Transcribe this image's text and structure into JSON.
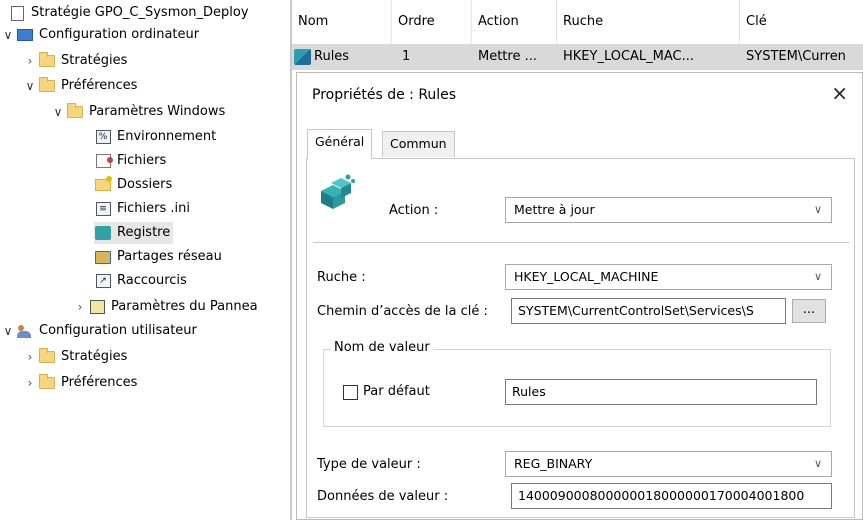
{
  "tree": {
    "root": "Stratégie GPO_C_Sysmon_Deploy",
    "items": [
      {
        "label": "Configuration ordinateur"
      },
      {
        "label": "Stratégies"
      },
      {
        "label": "Préférences"
      },
      {
        "label": "Paramètres Windows"
      },
      {
        "label": "Environnement"
      },
      {
        "label": "Fichiers"
      },
      {
        "label": "Dossiers"
      },
      {
        "label": "Fichiers .ini"
      },
      {
        "label": "Registre"
      },
      {
        "label": "Partages réseau"
      },
      {
        "label": "Raccourcis"
      },
      {
        "label": "Paramètres du Pannea"
      },
      {
        "label": "Configuration utilisateur"
      },
      {
        "label": "Stratégies"
      },
      {
        "label": "Préférences"
      }
    ],
    "selected": "Registre"
  },
  "list": {
    "columns": [
      "Nom",
      "Ordre",
      "Action",
      "Ruche",
      "Clé"
    ],
    "row": {
      "nom": "Rules",
      "ordre": "1",
      "action": "Mettre ...",
      "ruche": "HKEY_LOCAL_MAC...",
      "cle": "SYSTEM\\Curren"
    }
  },
  "dialog": {
    "title": "Propriétés de : Rules",
    "close": "×",
    "tabs": [
      "Général",
      "Commun"
    ],
    "action_label": "Action :",
    "action_value": "Mettre à jour",
    "ruche_label": "Ruche :",
    "ruche_value": "HKEY_LOCAL_MACHINE",
    "chemin_label": "Chemin d’accès de la clé :",
    "chemin_value": "SYSTEM\\CurrentControlSet\\Services\\S",
    "browse": "...",
    "nom_valeur_group": "Nom de valeur",
    "par_defaut": "Par défaut",
    "nom_valeur_value": "Rules",
    "type_label": "Type de valeur :",
    "type_value": "REG_BINARY",
    "donnees_label": "Données de valeur :",
    "donnees_value": "140009000800000018000000170004001800"
  },
  "colors": {
    "selection": "#d9d9d9",
    "tree_selection": "#e6e6e6"
  }
}
